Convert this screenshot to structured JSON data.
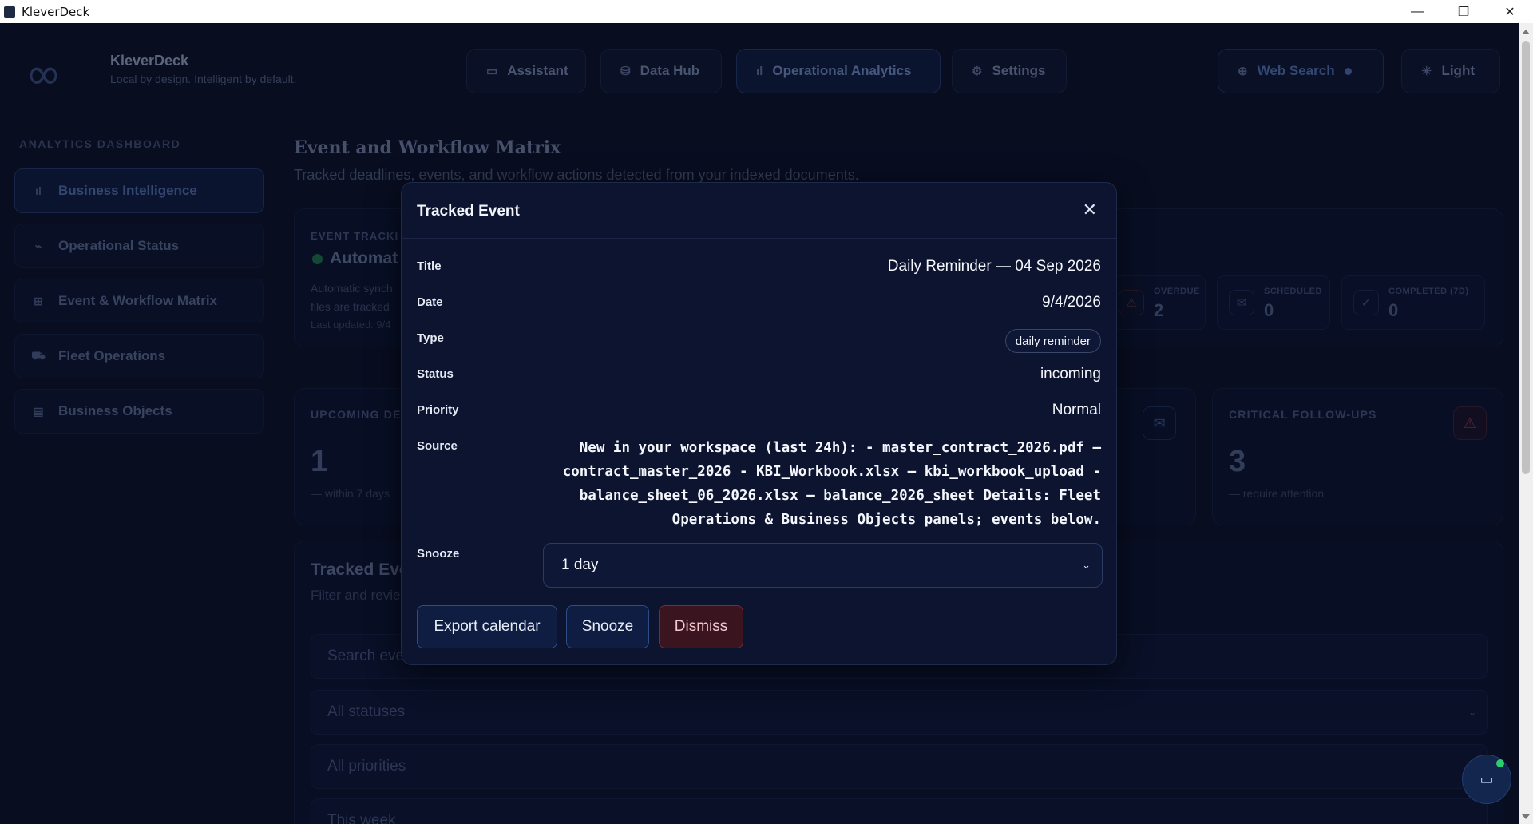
{
  "window": {
    "title": "KleverDeck",
    "controls": {
      "minimize": "—",
      "maximize": "❐",
      "close": "✕"
    }
  },
  "brand": {
    "name": "KleverDeck",
    "tagline": "Local by design. Intelligent by default.",
    "logo_glyph": "∞"
  },
  "nav": {
    "assistant": "Assistant",
    "data_hub": "Data Hub",
    "operational_analytics": "Operational Analytics",
    "settings": "Settings",
    "web_search": "Web Search",
    "theme": "Light"
  },
  "sidebar": {
    "heading": "ANALYTICS DASHBOARD",
    "items": [
      {
        "label": "Business Intelligence",
        "icon": "bar-chart-icon",
        "active": true
      },
      {
        "label": "Operational Status",
        "icon": "pulse-icon",
        "active": false
      },
      {
        "label": "Event & Workflow Matrix",
        "icon": "grid-icon",
        "active": false
      },
      {
        "label": "Fleet Operations",
        "icon": "truck-icon",
        "active": false
      },
      {
        "label": "Business Objects",
        "icon": "document-icon",
        "active": false
      }
    ]
  },
  "main": {
    "title": "Event and Workflow Matrix",
    "subtitle": "Tracked deadlines, events, and workflow actions detected from your indexed documents.",
    "tracker": {
      "label": "EVENT TRACKI",
      "status": "Automat",
      "desc_line1": "Automatic synch",
      "desc_line2": "files are tracked",
      "updated": "Last updated: 9/4"
    },
    "kpis": {
      "overdue": {
        "label": "OVERDUE",
        "value": "2"
      },
      "scheduled": {
        "label": "SCHEDULED",
        "value": "0"
      },
      "completed": {
        "label": "COMPLETED (7D)",
        "value": "0"
      }
    },
    "metrics": {
      "upcoming": {
        "label": "UPCOMING DE",
        "value": "1",
        "note": "— within 7 days"
      },
      "critical": {
        "label": "CRITICAL FOLLOW-UPS",
        "value": "3",
        "note": "— require attention"
      }
    },
    "events": {
      "title": "Tracked Eve",
      "subtitle": "Filter and revie",
      "search_placeholder": "Search eve",
      "status_filter": "All statuses",
      "priority_filter": "All priorities",
      "range_filter": "This week"
    }
  },
  "modal": {
    "title": "Tracked Event",
    "labels": {
      "title": "Title",
      "date": "Date",
      "type": "Type",
      "status": "Status",
      "priority": "Priority",
      "source": "Source",
      "snooze": "Snooze"
    },
    "values": {
      "title": "Daily Reminder — 04 Sep 2026",
      "date": "9/4/2026",
      "type": "daily reminder",
      "status": "incoming",
      "priority": "Normal",
      "source": "New in your workspace (last 24h): - master_contract_2026.pdf — contract_master_2026 - KBI_Workbook.xlsx — kbi_workbook_upload - balance_sheet_06_2026.xlsx — balance_2026_sheet Details: Fleet Operations & Business Objects panels; events below."
    },
    "snooze_selected": "1 day",
    "buttons": {
      "export": "Export calendar",
      "snooze": "Snooze",
      "dismiss": "Dismiss"
    }
  },
  "colors": {
    "background": "#0b1229",
    "modal_bg": "#0c1430",
    "accent": "#2c4e86",
    "danger": "#7a2a34",
    "online": "#2ecc71"
  }
}
